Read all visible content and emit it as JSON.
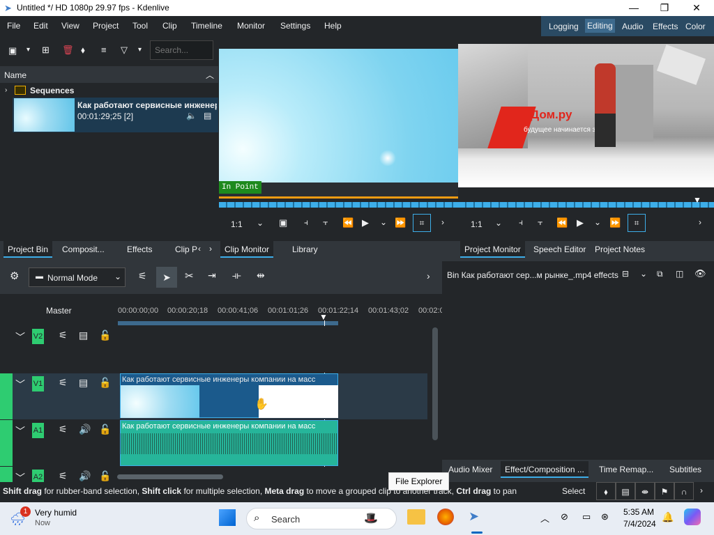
{
  "window": {
    "title": "Untitled */ HD 1080p 29.97 fps - Kdenlive",
    "minimize": "—",
    "maximize": "❐",
    "close": "✕"
  },
  "menu": [
    "File",
    "Edit",
    "View",
    "Project",
    "Tool",
    "Clip",
    "Timeline",
    "Monitor",
    "Settings",
    "Help"
  ],
  "workspaces": [
    "Logging",
    "Editing",
    "Audio",
    "Effects",
    "Color"
  ],
  "bin": {
    "search_placeholder": "Search...",
    "column_name": "Name",
    "folder": "Sequences",
    "clip_title": "Как работают сервисные инженер",
    "clip_duration": "00:01:29;25 [2]"
  },
  "left_tabs": [
    "Project Bin",
    "Composit...",
    "Effects",
    "Clip P"
  ],
  "clip_monitor": {
    "in_point": "In Point",
    "zoom": "1:1"
  },
  "center_tabs": [
    "Clip Monitor",
    "Library"
  ],
  "project_monitor": {
    "zoom": "1:1",
    "overlay_brand": "Дом.ру",
    "overlay_slogan": "будущее начинается здесь!"
  },
  "right_tabs": [
    "Project Monitor",
    "Speech Editor",
    "Project Notes"
  ],
  "timeline_toolbar": {
    "mode": "Normal Mode"
  },
  "timeline": {
    "master_label": "Master",
    "timecodes": [
      "00:00:00;00",
      "00:00:20;18",
      "00:00:41;06",
      "00:01:01;26",
      "00:01:22;14",
      "00:01:43;02",
      "00:02:0"
    ],
    "tracks": [
      "V2",
      "V1",
      "A1",
      "A2"
    ],
    "clip_video_label": "Как работают сервисные инженеры компании на масс",
    "clip_audio_label": "Как работают сервисные инженеры компании на масс"
  },
  "effects_panel": {
    "title": "Bin Как работают сер...м рынке_.mp4 effects"
  },
  "bottom_right_tabs": [
    "Audio Mixer",
    "Effect/Composition ...",
    "Time Remap...",
    "Subtitles"
  ],
  "status": {
    "p1b": "Shift drag",
    "p1": " for rubber-band selection, ",
    "p2b": "Shift click",
    "p2": " for multiple selection, ",
    "p3b": "Meta drag",
    "p3": " to move a grouped clip to another track, ",
    "p4b": "Ctrl drag",
    "p4": " to pan",
    "select": "Select"
  },
  "tooltip": "File Explorer",
  "taskbar": {
    "weather_title": "Very humid",
    "weather_sub": "Now",
    "badge": "1",
    "search": "Search",
    "time": "5:35 AM",
    "date": "7/4/2024"
  },
  "colors": {
    "accent": "#3daee9",
    "track_green": "#2ecc71",
    "audio_clip": "#26b59a",
    "in_point": "#1e8a1e"
  }
}
